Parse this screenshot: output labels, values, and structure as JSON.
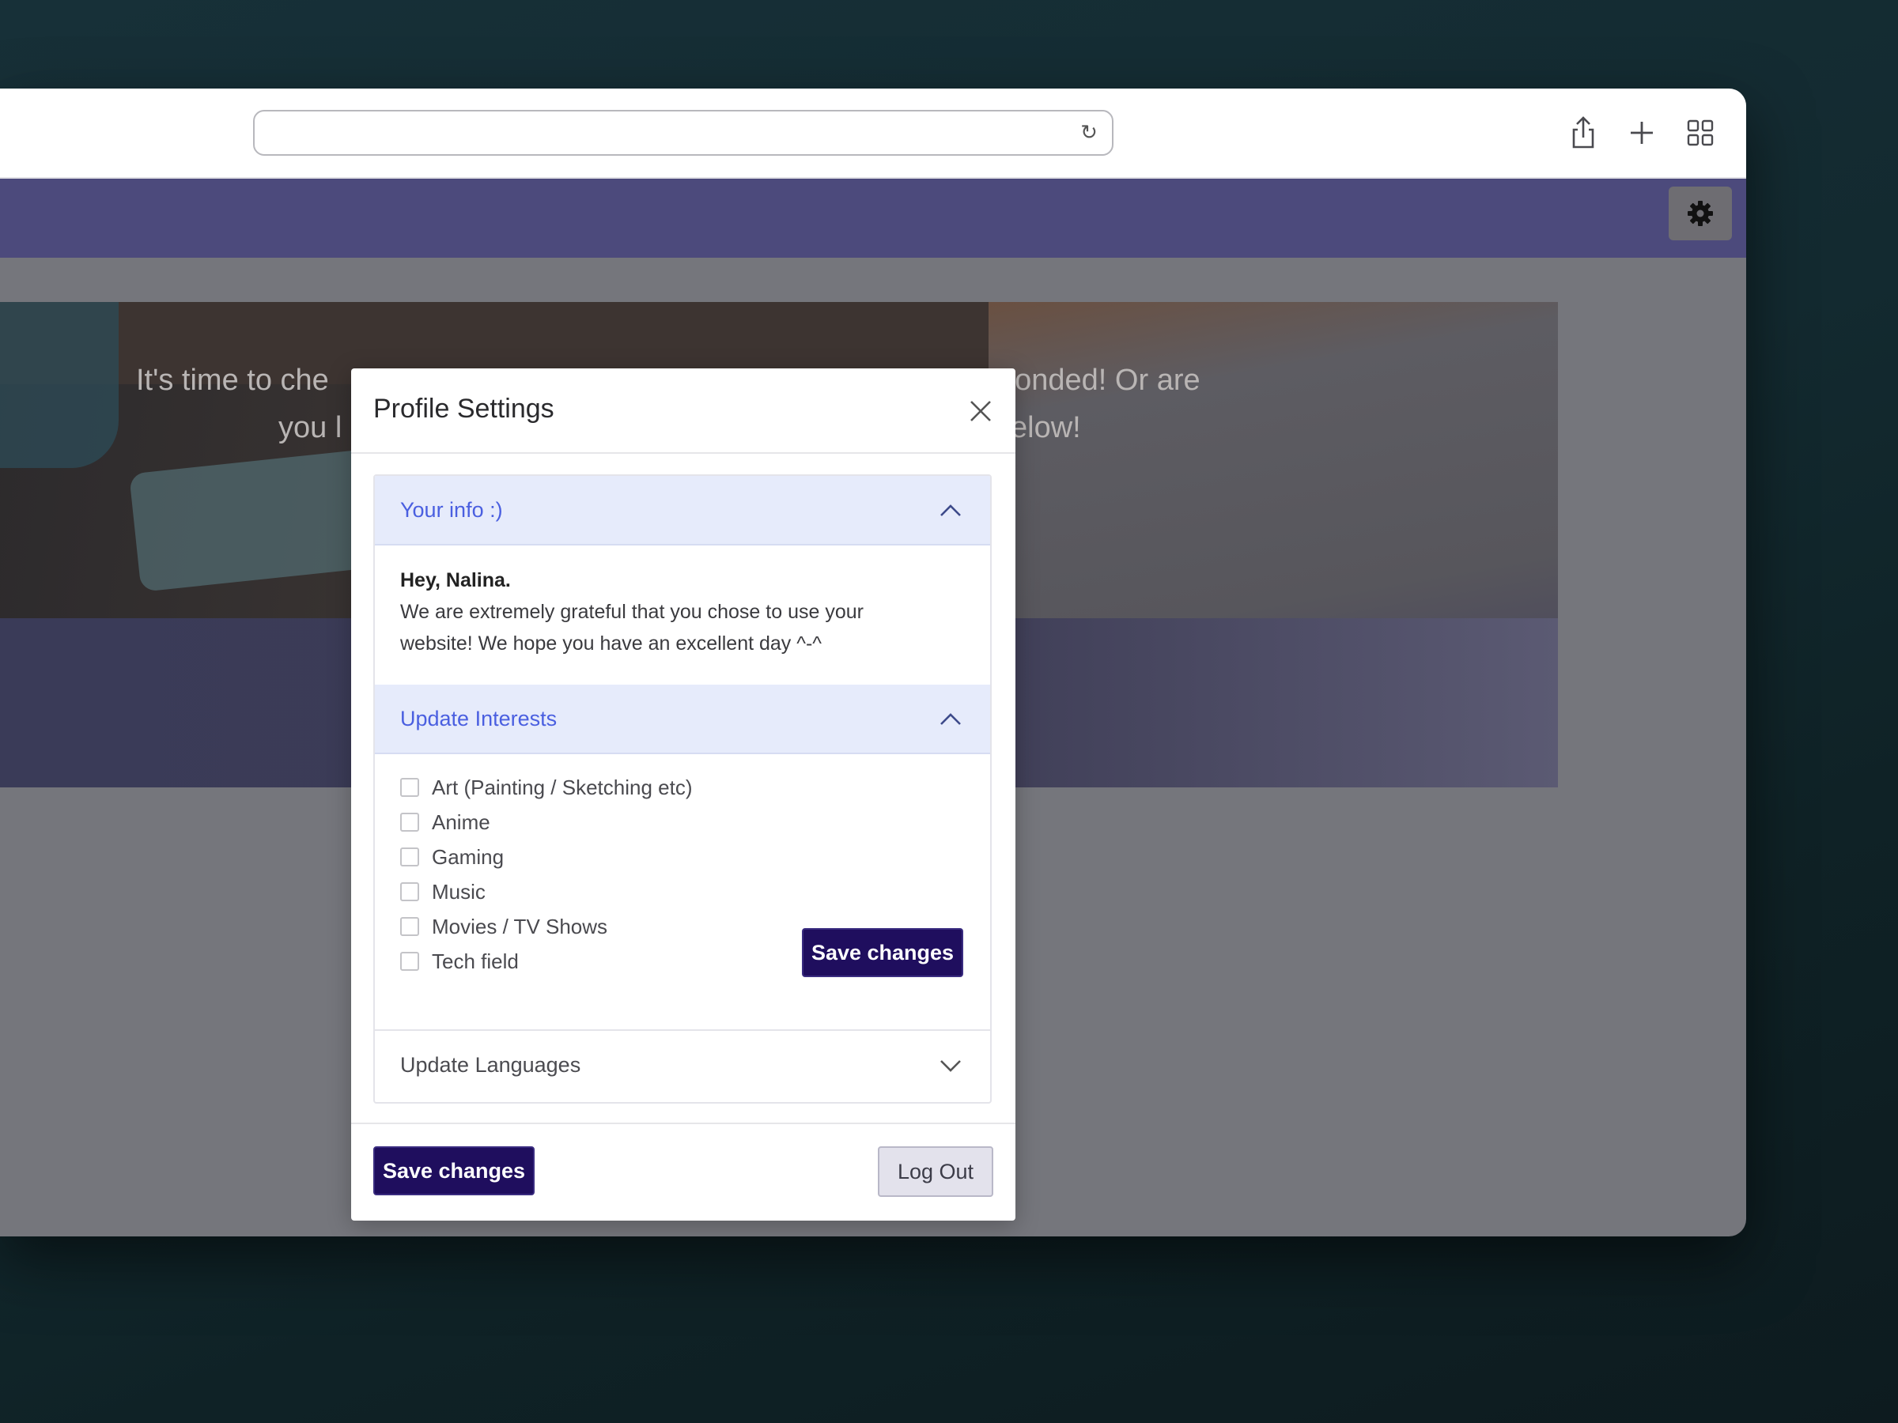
{
  "browser": {
    "url": "",
    "icons": [
      "reload-icon",
      "share-icon",
      "plus-icon",
      "tabs-grid-icon"
    ]
  },
  "navbar": {
    "settings_icon": "gear-icon",
    "color": "#4c4a7c"
  },
  "hero": {
    "line1_left": "It's time to che",
    "line2_left": "you l",
    "line1_right": "ponded! Or are",
    "line2_right": "elow!"
  },
  "modal": {
    "title": "Profile Settings",
    "close_icon": "close-icon",
    "sections": {
      "info": {
        "title": "Your info :)",
        "greeting": "Hey, Nalina.",
        "message_line1": "We are extremely grateful that you chose to use your",
        "message_line2": "website! We hope you have an excellent day ^-^"
      },
      "interests": {
        "title": "Update Interests",
        "items": [
          "Art (Painting / Sketching etc)",
          "Anime",
          "Gaming",
          "Music",
          "Movies / TV Shows",
          "Tech field"
        ],
        "save_label": "Save changes"
      },
      "languages": {
        "title": "Update Languages"
      }
    },
    "footer": {
      "save_label": "Save changes",
      "logout_label": "Log Out"
    }
  },
  "colors": {
    "accent": "#1f0e5e",
    "accordion_active_bg": "#e6ebfb",
    "accordion_active_text": "#4a5fe0"
  }
}
